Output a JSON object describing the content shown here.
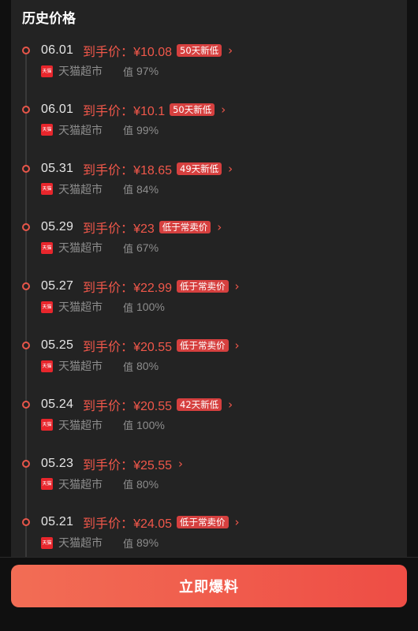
{
  "section": {
    "title": "历史价格"
  },
  "price_prefix": "到手价：",
  "store_icon_text": "天猫",
  "worth_icon": "值",
  "chevron": "›",
  "entries": [
    {
      "date": "06.01",
      "price": "¥10.08",
      "badge": "50天新低",
      "store": "天猫超市",
      "worth": "97%"
    },
    {
      "date": "06.01",
      "price": "¥10.1",
      "badge": "50天新低",
      "store": "天猫超市",
      "worth": "99%"
    },
    {
      "date": "05.31",
      "price": "¥18.65",
      "badge": "49天新低",
      "store": "天猫超市",
      "worth": "84%"
    },
    {
      "date": "05.29",
      "price": "¥23",
      "badge": "低于常卖价",
      "store": "天猫超市",
      "worth": "67%"
    },
    {
      "date": "05.27",
      "price": "¥22.99",
      "badge": "低于常卖价",
      "store": "天猫超市",
      "worth": "100%"
    },
    {
      "date": "05.25",
      "price": "¥20.55",
      "badge": "低于常卖价",
      "store": "天猫超市",
      "worth": "80%"
    },
    {
      "date": "05.24",
      "price": "¥20.55",
      "badge": "42天新低",
      "store": "天猫超市",
      "worth": "100%"
    },
    {
      "date": "05.23",
      "price": "¥25.55",
      "badge": "",
      "store": "天猫超市",
      "worth": "80%"
    },
    {
      "date": "05.21",
      "price": "¥24.05",
      "badge": "低于常卖价",
      "store": "天猫超市",
      "worth": "89%"
    }
  ],
  "footer": {
    "cta_label": "立即爆料"
  },
  "colors": {
    "accent": "#f0574a",
    "badge_bg": "#d6403f",
    "card_bg": "#232323",
    "page_bg": "#101010"
  }
}
